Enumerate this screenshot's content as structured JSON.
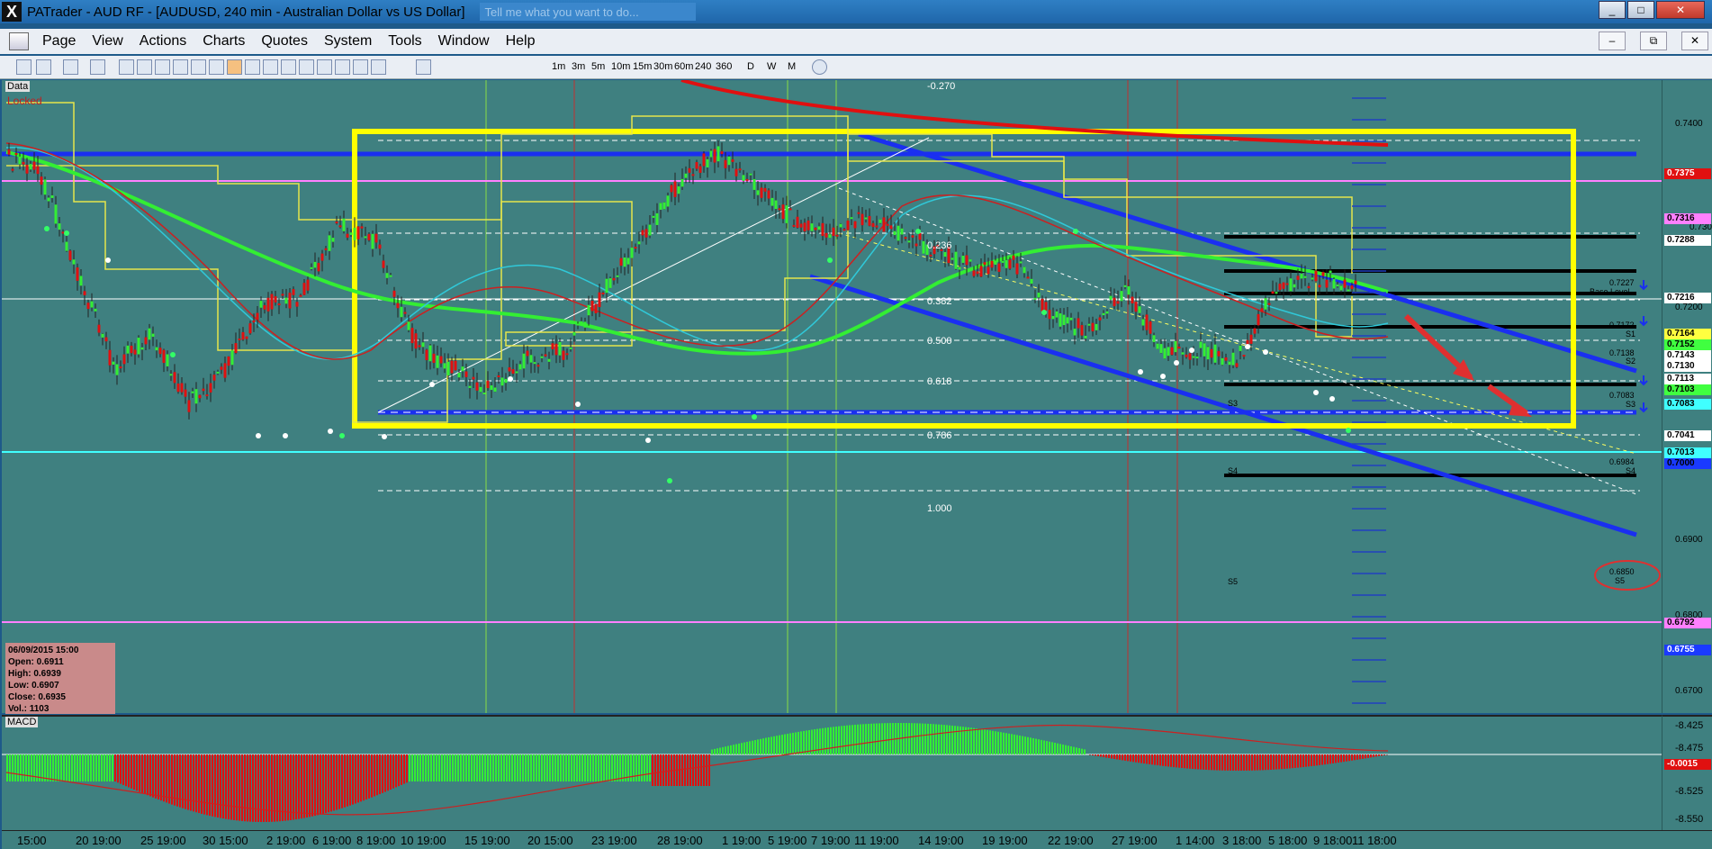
{
  "window": {
    "title": "PATrader - AUD RF - [AUDUSD, 240 min - Australian Dollar vs US Dollar]",
    "tell_me_placeholder": "Tell me what you want to do...",
    "logo": "X",
    "controls": [
      "_",
      "□",
      "✕"
    ]
  },
  "menu": {
    "items": [
      "Page",
      "View",
      "Actions",
      "Charts",
      "Quotes",
      "System",
      "Tools",
      "Window",
      "Help"
    ],
    "mdi_controls": [
      "–",
      "⧉",
      "✕"
    ]
  },
  "toolbar": {
    "timeframes": [
      "1m",
      "3m",
      "5m",
      "10m",
      "15m",
      "30m",
      "60m",
      "240",
      "360",
      "D",
      "W",
      "M"
    ]
  },
  "chart": {
    "data_tag": "Data",
    "locked_tag": "Locked",
    "macd_tag": "MACD",
    "ohlc": {
      "date": "06/09/2015 15:00",
      "open": "Open: 0.6911",
      "high": "High: 0.6939",
      "low": "Low: 0.6907",
      "close": "Close: 0.6935",
      "vol": "Vol.: 1103"
    },
    "fib_labels": [
      "-0.270",
      "0.236",
      "0.382",
      "0.500",
      "0.618",
      "0.786",
      "1.000"
    ],
    "level_labels": [
      "0.7227",
      "Base Level",
      "0.7172",
      "S1",
      "0.7138",
      "S2",
      "0.7083",
      "S3",
      "0.6984",
      "S4",
      "0.6850",
      "S5",
      "S3",
      "S4",
      "S5"
    ]
  },
  "price_axis": {
    "tags": [
      {
        "text": "0.7375",
        "bg": "#e01010",
        "fg": "#ffffff"
      },
      {
        "text": "0.7316",
        "bg": "#ff80ff",
        "fg": "#000000"
      },
      {
        "text": "0.7288",
        "bg": "#ffffff",
        "fg": "#000000"
      },
      {
        "text": "0.7216",
        "bg": "#ffffff",
        "fg": "#000000"
      },
      {
        "text": "0.7164",
        "bg": "#ffff40",
        "fg": "#000000"
      },
      {
        "text": "0.7152",
        "bg": "#40ff40",
        "fg": "#000000"
      },
      {
        "text": "0.7143",
        "bg": "#ffffff",
        "fg": "#000000"
      },
      {
        "text": "0.7130",
        "bg": "#ffffff",
        "fg": "#000000"
      },
      {
        "text": "0.7113",
        "bg": "#ffffff",
        "fg": "#000000"
      },
      {
        "text": "0.7103",
        "bg": "#40ff40",
        "fg": "#000000"
      },
      {
        "text": "0.7083",
        "bg": "#40ffff",
        "fg": "#000000"
      },
      {
        "text": "0.7041",
        "bg": "#ffffff",
        "fg": "#000000"
      },
      {
        "text": "0.7013",
        "bg": "#40ffff",
        "fg": "#000000"
      },
      {
        "text": "0.7000",
        "bg": "#1a3aff",
        "fg": "#000000"
      },
      {
        "text": "0.6792",
        "bg": "#ff80ff",
        "fg": "#000000"
      },
      {
        "text": "0.6755",
        "bg": "#1a3aff",
        "fg": "#ffffff"
      }
    ],
    "labels": [
      "0.7400",
      "0.7300",
      "0.7200",
      "0.6900",
      "0.6800",
      "0.6700"
    ]
  },
  "macd_axis": {
    "labels": [
      "-8.425",
      "-8.475",
      "-8.525",
      "-8.550"
    ],
    "tag": "-0.0015"
  },
  "time_axis": {
    "labels": [
      "15:00",
      "20 19:00",
      "25 19:00",
      "30 15:00",
      "2 19:00",
      "6 19:00",
      "8 19:00",
      "10 19:00",
      "15 19:00",
      "20 15:00",
      "23 19:00",
      "28 19:00",
      "1 19:00",
      "5 19:00",
      "7 19:00",
      "11 19:00",
      "14 19:00",
      "19 19:00",
      "22 19:00",
      "27 19:00",
      "1 14:00",
      "3 18:00",
      "5 18:00",
      "9 18:00",
      "11 18:00"
    ]
  },
  "colors": {
    "chart_bg": "#3f8080",
    "channel": "#1a2ff0",
    "box": "#ffff00",
    "ma_green": "#33ee33",
    "ma_red": "#e01010",
    "ma_cyan": "#30c8d8"
  }
}
